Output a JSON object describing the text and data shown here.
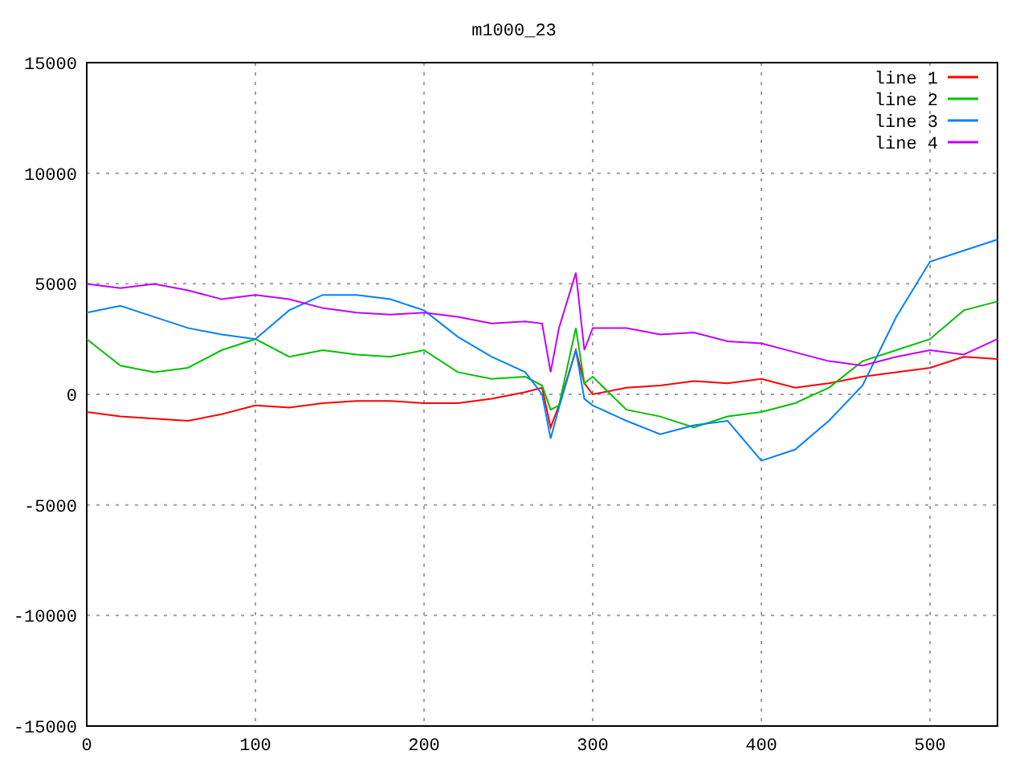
{
  "chart_data": {
    "type": "line",
    "title": "m1000_23",
    "x": [
      0,
      20,
      40,
      60,
      80,
      100,
      120,
      140,
      160,
      180,
      200,
      220,
      240,
      260,
      270,
      275,
      280,
      290,
      295,
      300,
      320,
      340,
      360,
      380,
      400,
      420,
      440,
      460,
      480,
      500,
      520,
      540
    ],
    "series": [
      {
        "name": "line 1",
        "color": "#ff0000",
        "values": [
          -800,
          -1000,
          -1100,
          -1200,
          -900,
          -500,
          -600,
          -400,
          -300,
          -300,
          -400,
          -400,
          -200,
          100,
          300,
          -1500,
          -500,
          2000,
          500,
          0,
          300,
          400,
          600,
          500,
          700,
          300,
          500,
          800,
          1000,
          1200,
          1700,
          1600
        ]
      },
      {
        "name": "line 2",
        "color": "#00c000",
        "values": [
          2500,
          1300,
          1000,
          1200,
          2000,
          2500,
          1700,
          2000,
          1800,
          1700,
          2000,
          1000,
          700,
          800,
          400,
          -700,
          -500,
          3000,
          500,
          800,
          -700,
          -1000,
          -1500,
          -1000,
          -800,
          -400,
          300,
          1500,
          2000,
          2500,
          3800,
          4200
        ]
      },
      {
        "name": "line 3",
        "color": "#0080ff",
        "values": [
          3700,
          4000,
          3500,
          3000,
          2700,
          2500,
          3800,
          4500,
          4500,
          4300,
          3800,
          2600,
          1700,
          1000,
          0,
          -2000,
          -600,
          2000,
          -200,
          -500,
          -1200,
          -1800,
          -1400,
          -1200,
          -3000,
          -2500,
          -1200,
          400,
          3500,
          6000,
          6500,
          7000
        ]
      },
      {
        "name": "line 4",
        "color": "#c000ff",
        "values": [
          5000,
          4800,
          5000,
          4700,
          4300,
          4500,
          4300,
          3900,
          3700,
          3600,
          3700,
          3500,
          3200,
          3300,
          3200,
          1000,
          3000,
          5500,
          2000,
          3000,
          3000,
          2700,
          2800,
          2400,
          2300,
          1900,
          1500,
          1300,
          1700,
          2000,
          1800,
          2500
        ]
      }
    ],
    "xlim": [
      0,
      540
    ],
    "ylim": [
      -15000,
      15000
    ],
    "xticks": [
      0,
      100,
      200,
      300,
      400,
      500
    ],
    "yticks": [
      -15000,
      -10000,
      -5000,
      0,
      5000,
      10000,
      15000
    ],
    "grid": true,
    "legend": true
  }
}
